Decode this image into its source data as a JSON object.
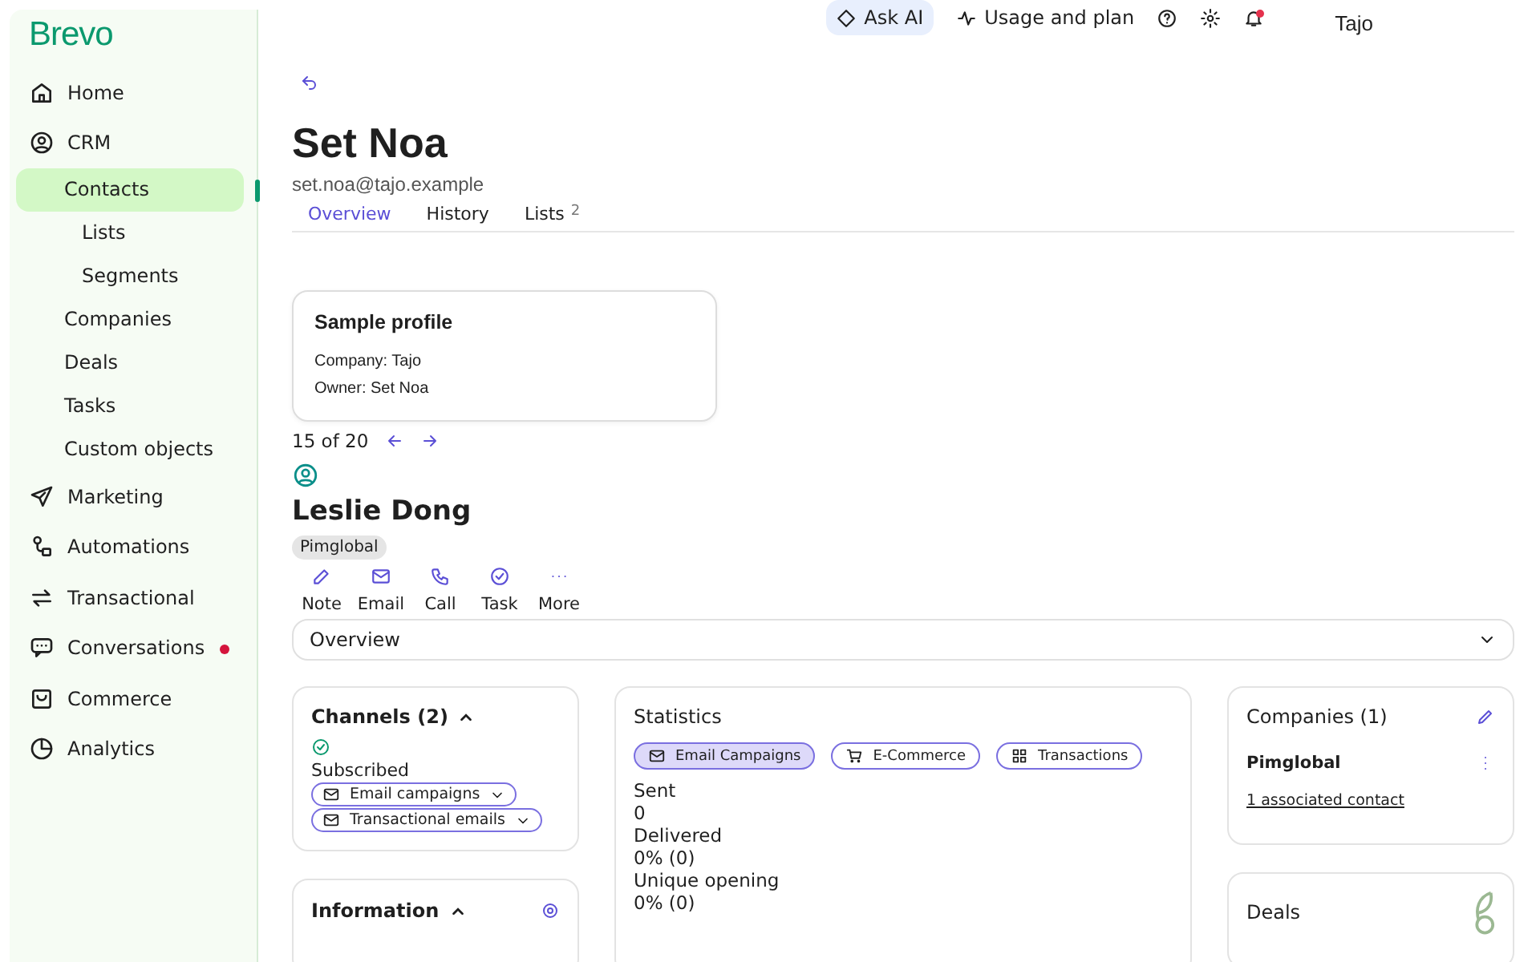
{
  "sidebar": {
    "logo": "Brevo",
    "items": [
      {
        "label": "Home",
        "selected": false,
        "notification": false
      },
      {
        "label": "CRM",
        "selected": false,
        "notification": false,
        "children": [
          {
            "label": "Contacts",
            "selected": true,
            "children": [
              {
                "label": "Lists",
                "selected": false
              },
              {
                "label": "Segments",
                "selected": false
              }
            ]
          },
          {
            "label": "Companies",
            "selected": false
          },
          {
            "label": "Deals",
            "selected": false
          },
          {
            "label": "Tasks",
            "selected": false
          },
          {
            "label": "Custom objects",
            "selected": false
          }
        ]
      },
      {
        "label": "Marketing",
        "selected": false,
        "notification": false
      },
      {
        "label": "Automations",
        "selected": false,
        "notification": false
      },
      {
        "label": "Transactional",
        "selected": false,
        "notification": false
      },
      {
        "label": "Conversations",
        "selected": false,
        "notification": true
      },
      {
        "label": "Commerce",
        "selected": false,
        "notification": false
      },
      {
        "label": "Analytics",
        "selected": false,
        "notification": false
      }
    ]
  },
  "topbar": {
    "ask_ai": "Ask AI",
    "usage": "Usage and plan",
    "notification": true,
    "account": "Tajo"
  },
  "header": {
    "title": "Set Noa",
    "email": "set.noa@tajo.example"
  },
  "tabs": [
    {
      "label": "Overview",
      "selected": true
    },
    {
      "label": "History",
      "selected": false
    },
    {
      "label": "Lists",
      "count": "2",
      "selected": false
    }
  ],
  "popover": {
    "title": "Sample profile",
    "lines": [
      "Company: Tajo",
      "Owner: Set Noa"
    ]
  },
  "pager": "15 of 20",
  "contact": {
    "name": "Leslie Dong",
    "tag": "Pimglobal",
    "actions": [
      "Note",
      "Email",
      "Call",
      "Task",
      "More"
    ]
  },
  "section_select": "Overview",
  "channels": {
    "title": "Channels (2)",
    "expanded": true,
    "status": "Subscribed",
    "subscriptions": [
      "Email campaigns",
      "Transactional emails"
    ]
  },
  "information": {
    "title": "Information",
    "expanded": true
  },
  "statistics": {
    "title": "Statistics",
    "filters": [
      {
        "label": "Email Campaigns",
        "selected": true
      },
      {
        "label": "E-Commerce",
        "selected": false
      },
      {
        "label": "Transactions",
        "selected": false
      }
    ],
    "metrics": [
      {
        "label": "Sent",
        "value": "0"
      },
      {
        "label": "Delivered",
        "value": "0% (0)"
      },
      {
        "label": "Unique opening",
        "value": "0% (0)"
      }
    ]
  },
  "companies": {
    "title": "Companies (1)",
    "name": "Pimglobal",
    "link": "1 associated contact"
  },
  "deals": {
    "title": "Deals"
  }
}
